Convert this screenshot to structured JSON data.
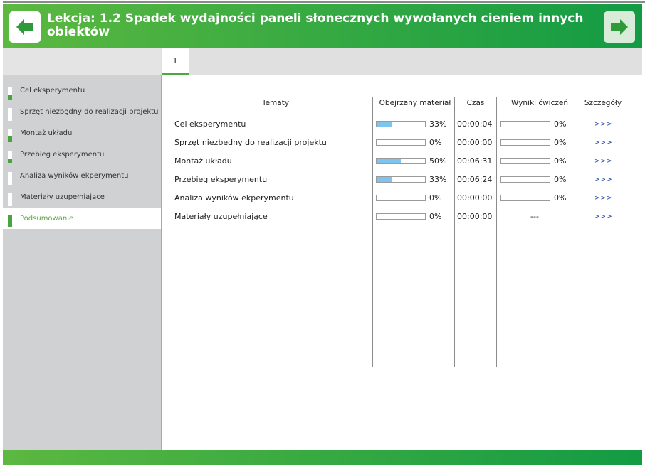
{
  "header": {
    "title": "Lekcja: 1.2 Spadek wydajności paneli słonecznych wywołanych cieniem innych obiektów",
    "prev_icon": "arrow-left-icon",
    "next_icon": "arrow-right-icon"
  },
  "tabs": [
    {
      "label": "1"
    }
  ],
  "sidebar": {
    "items": [
      {
        "label": "Cel eksperymentu",
        "progress": 0.33,
        "active": false
      },
      {
        "label": "Sprzęt niezbędny do realizacji projektu",
        "progress": 0,
        "active": false
      },
      {
        "label": "Montaż układu",
        "progress": 0.5,
        "active": false
      },
      {
        "label": "Przebieg eksperymentu",
        "progress": 0.33,
        "active": false
      },
      {
        "label": "Analiza wyników ekperymentu",
        "progress": 0,
        "active": false
      },
      {
        "label": "Materiały uzupełniające",
        "progress": 0,
        "active": false
      },
      {
        "label": "Podsumowanie",
        "progress": 1,
        "active": true
      }
    ]
  },
  "table": {
    "headers": {
      "topics": "Tematy",
      "viewed": "Obejrzany materiał",
      "time": "Czas",
      "results": "Wyniki ćwiczeń",
      "details": "Szczegóły"
    },
    "rows": [
      {
        "topic": "Cel eksperymentu",
        "viewed_pct": 33,
        "viewed_label": "33%",
        "time": "00:00:04",
        "results_pct": 0,
        "results_label": "0%",
        "details": ">>>"
      },
      {
        "topic": "Sprzęt niezbędny do realizacji projektu",
        "viewed_pct": 0,
        "viewed_label": "0%",
        "time": "00:00:00",
        "results_pct": 0,
        "results_label": "0%",
        "details": ">>>"
      },
      {
        "topic": "Montaż układu",
        "viewed_pct": 50,
        "viewed_label": "50%",
        "time": "00:06:31",
        "results_pct": 0,
        "results_label": "0%",
        "details": ">>>"
      },
      {
        "topic": "Przebieg eksperymentu",
        "viewed_pct": 33,
        "viewed_label": "33%",
        "time": "00:06:24",
        "results_pct": 0,
        "results_label": "0%",
        "details": ">>>"
      },
      {
        "topic": "Analiza wyników ekperymentu",
        "viewed_pct": 0,
        "viewed_label": "0%",
        "time": "00:00:00",
        "results_pct": 0,
        "results_label": "0%",
        "details": ">>>"
      },
      {
        "topic": "Materiały uzupełniające",
        "viewed_pct": 0,
        "viewed_label": "0%",
        "time": "00:00:00",
        "results_text": "---",
        "details": ">>>"
      }
    ]
  },
  "colors": {
    "header_green": "#3aab42",
    "progress_blue": "#7fc3ef",
    "link_blue": "#1a3d9e",
    "sidebar_green": "#4aa43e"
  }
}
